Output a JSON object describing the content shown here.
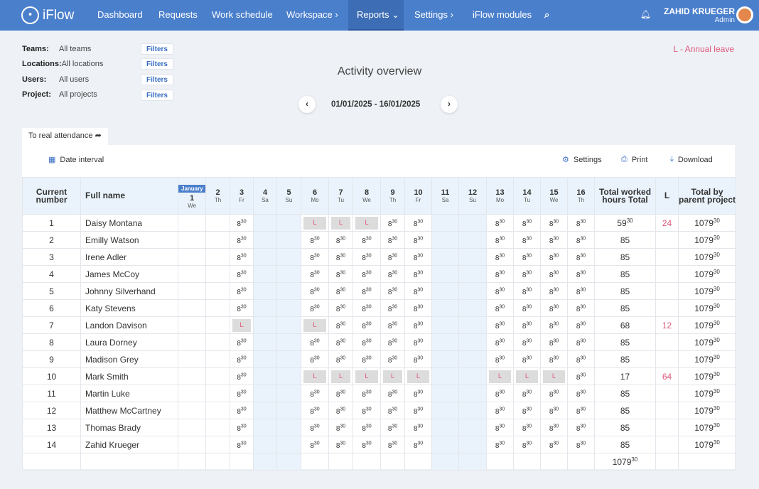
{
  "nav": {
    "brand": "iFlow",
    "items": [
      "Dashboard",
      "Requests",
      "Work schedule",
      "Workspace",
      "Reports",
      "Settings",
      "iFlow modules"
    ],
    "active_index": 4,
    "user_name": "ZAHID KRUEGER",
    "user_role": "Admin",
    "accent": "#4a7fcc"
  },
  "filters": [
    {
      "key": "Teams:",
      "value": "All teams",
      "button": "Filters"
    },
    {
      "key": "Locations:",
      "value": "All locations",
      "button": "Filters"
    },
    {
      "key": "Users:",
      "value": "All users",
      "button": "Filters"
    },
    {
      "key": "Project:",
      "value": "All projects",
      "button": "Filters"
    }
  ],
  "legend": "L - Annual leave",
  "title": "Activity overview",
  "date_range": "01/01/2025 - 16/01/2025",
  "tab_label": "To real attendance",
  "toolbar": {
    "date_interval": "Date interval",
    "settings": "Settings",
    "print": "Print",
    "download": "Download"
  },
  "table": {
    "headers": {
      "number": "Current number",
      "name": "Full name",
      "month": "January",
      "total_hours": "Total worked hours Total",
      "leave": "L",
      "total_parent": "Total by parent project"
    },
    "days": [
      {
        "num": "1",
        "name": "We",
        "weekend": false
      },
      {
        "num": "2",
        "name": "Th",
        "weekend": false
      },
      {
        "num": "3",
        "name": "Fr",
        "weekend": false
      },
      {
        "num": "4",
        "name": "Sa",
        "weekend": true
      },
      {
        "num": "5",
        "name": "Su",
        "weekend": true
      },
      {
        "num": "6",
        "name": "Mo",
        "weekend": false
      },
      {
        "num": "7",
        "name": "Tu",
        "weekend": false
      },
      {
        "num": "8",
        "name": "We",
        "weekend": false
      },
      {
        "num": "9",
        "name": "Th",
        "weekend": false
      },
      {
        "num": "10",
        "name": "Fr",
        "weekend": false
      },
      {
        "num": "11",
        "name": "Sa",
        "weekend": true
      },
      {
        "num": "12",
        "name": "Su",
        "weekend": true
      },
      {
        "num": "13",
        "name": "Mo",
        "weekend": false
      },
      {
        "num": "14",
        "name": "Tu",
        "weekend": false
      },
      {
        "num": "15",
        "name": "We",
        "weekend": false
      },
      {
        "num": "16",
        "name": "Th",
        "weekend": false
      }
    ],
    "hours_base": "8",
    "hours_sup": "30",
    "rows": [
      {
        "num": "1",
        "name": "Daisy Montana",
        "cells": [
          "",
          "",
          "H",
          "",
          "",
          "L",
          "L",
          "L",
          "H",
          "H",
          "",
          "",
          "H",
          "H",
          "H",
          "H"
        ],
        "total": "59",
        "total_sup": "30",
        "leave": "24",
        "parent": "1079",
        "parent_sup": "30"
      },
      {
        "num": "2",
        "name": "Emilly Watson",
        "cells": [
          "",
          "",
          "H",
          "",
          "",
          "H",
          "H",
          "H",
          "H",
          "H",
          "",
          "",
          "H",
          "H",
          "H",
          "H"
        ],
        "total": "85",
        "total_sup": "",
        "leave": "",
        "parent": "1079",
        "parent_sup": "30"
      },
      {
        "num": "3",
        "name": "Irene Adler",
        "cells": [
          "",
          "",
          "H",
          "",
          "",
          "H",
          "H",
          "H",
          "H",
          "H",
          "",
          "",
          "H",
          "H",
          "H",
          "H"
        ],
        "total": "85",
        "total_sup": "",
        "leave": "",
        "parent": "1079",
        "parent_sup": "30"
      },
      {
        "num": "4",
        "name": "James McCoy",
        "cells": [
          "",
          "",
          "H",
          "",
          "",
          "H",
          "H",
          "H",
          "H",
          "H",
          "",
          "",
          "H",
          "H",
          "H",
          "H"
        ],
        "total": "85",
        "total_sup": "",
        "leave": "",
        "parent": "1079",
        "parent_sup": "30"
      },
      {
        "num": "5",
        "name": "Johnny Silverhand",
        "cells": [
          "",
          "",
          "H",
          "",
          "",
          "H",
          "H",
          "H",
          "H",
          "H",
          "",
          "",
          "H",
          "H",
          "H",
          "H"
        ],
        "total": "85",
        "total_sup": "",
        "leave": "",
        "parent": "1079",
        "parent_sup": "30"
      },
      {
        "num": "6",
        "name": "Katy Stevens",
        "cells": [
          "",
          "",
          "H",
          "",
          "",
          "H",
          "H",
          "H",
          "H",
          "H",
          "",
          "",
          "H",
          "H",
          "H",
          "H"
        ],
        "total": "85",
        "total_sup": "",
        "leave": "",
        "parent": "1079",
        "parent_sup": "30"
      },
      {
        "num": "7",
        "name": "Landon Davison",
        "cells": [
          "",
          "",
          "L",
          "",
          "",
          "L",
          "H",
          "H",
          "H",
          "H",
          "",
          "",
          "H",
          "H",
          "H",
          "H"
        ],
        "total": "68",
        "total_sup": "",
        "leave": "12",
        "parent": "1079",
        "parent_sup": "30"
      },
      {
        "num": "8",
        "name": "Laura Dorney",
        "cells": [
          "",
          "",
          "H",
          "",
          "",
          "H",
          "H",
          "H",
          "H",
          "H",
          "",
          "",
          "H",
          "H",
          "H",
          "H"
        ],
        "total": "85",
        "total_sup": "",
        "leave": "",
        "parent": "1079",
        "parent_sup": "30"
      },
      {
        "num": "9",
        "name": "Madison Grey",
        "cells": [
          "",
          "",
          "H",
          "",
          "",
          "H",
          "H",
          "H",
          "H",
          "H",
          "",
          "",
          "H",
          "H",
          "H",
          "H"
        ],
        "total": "85",
        "total_sup": "",
        "leave": "",
        "parent": "1079",
        "parent_sup": "30"
      },
      {
        "num": "10",
        "name": "Mark Smith",
        "cells": [
          "",
          "",
          "H",
          "",
          "",
          "L",
          "L",
          "L",
          "L",
          "L",
          "",
          "",
          "L",
          "L",
          "L",
          "H"
        ],
        "total": "17",
        "total_sup": "",
        "leave": "64",
        "parent": "1079",
        "parent_sup": "30"
      },
      {
        "num": "11",
        "name": "Martin Luke",
        "cells": [
          "",
          "",
          "H",
          "",
          "",
          "H",
          "H",
          "H",
          "H",
          "H",
          "",
          "",
          "H",
          "H",
          "H",
          "H"
        ],
        "total": "85",
        "total_sup": "",
        "leave": "",
        "parent": "1079",
        "parent_sup": "30"
      },
      {
        "num": "12",
        "name": "Matthew McCartney",
        "cells": [
          "",
          "",
          "H",
          "",
          "",
          "H",
          "H",
          "H",
          "H",
          "H",
          "",
          "",
          "H",
          "H",
          "H",
          "H"
        ],
        "total": "85",
        "total_sup": "",
        "leave": "",
        "parent": "1079",
        "parent_sup": "30"
      },
      {
        "num": "13",
        "name": "Thomas Brady",
        "cells": [
          "",
          "",
          "H",
          "",
          "",
          "H",
          "H",
          "H",
          "H",
          "H",
          "",
          "",
          "H",
          "H",
          "H",
          "H"
        ],
        "total": "85",
        "total_sup": "",
        "leave": "",
        "parent": "1079",
        "parent_sup": "30"
      },
      {
        "num": "14",
        "name": "Zahid Krueger",
        "cells": [
          "",
          "",
          "H",
          "",
          "",
          "H",
          "H",
          "H",
          "H",
          "H",
          "",
          "",
          "H",
          "H",
          "H",
          "H"
        ],
        "total": "85",
        "total_sup": "",
        "leave": "",
        "parent": "1079",
        "parent_sup": "30"
      }
    ],
    "grand_total": "1079",
    "grand_total_sup": "30"
  }
}
